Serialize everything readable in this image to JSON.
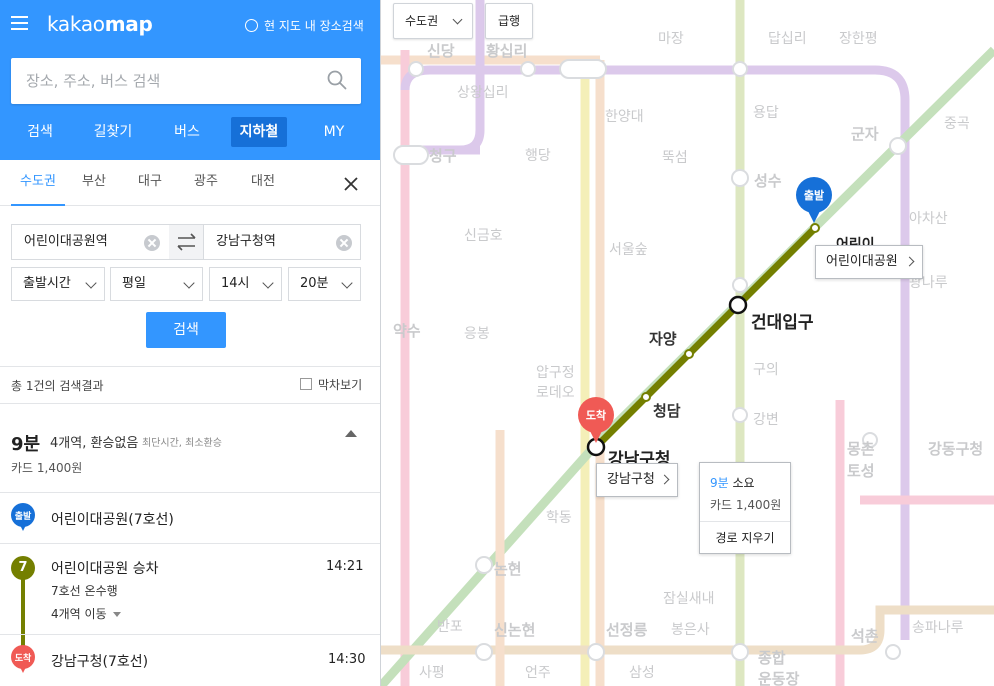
{
  "header": {
    "logo_kakao": "kakao",
    "logo_map": "map",
    "radio_label": "현 지도 내 장소검색",
    "search_placeholder": "장소, 주소, 버스 검색"
  },
  "nav_tabs": [
    "검색",
    "길찾기",
    "버스",
    "지하철",
    "MY"
  ],
  "active_nav_tab": "지하철",
  "regions": [
    "수도권",
    "부산",
    "대구",
    "광주",
    "대전"
  ],
  "active_region": "수도권",
  "route_form": {
    "origin": "어린이대공원역",
    "destination": "강남구청역",
    "time_type": "출발시간",
    "day_type": "평일",
    "hour": "14시",
    "minute": "20분",
    "search_button": "검색"
  },
  "results": {
    "count_text": "총 1건의 검색결과",
    "last_train_label": "막차보기",
    "route": {
      "duration": "9분",
      "info": "4개역, 환승없음",
      "tags": "최단시간, 최소환승",
      "fare": "카드 1,400원"
    },
    "steps": {
      "start_pin": "출발",
      "start_name": "어린이대공원(7호선)",
      "line_number": "7",
      "board_name": "어린이대공원 승차",
      "board_time": "14:21",
      "direction": "7호선 온수행",
      "stops": "4개역 이동",
      "end_pin": "도착",
      "end_name": "강남구청(7호선)",
      "end_time": "14:30"
    }
  },
  "map": {
    "region_button": "수도권",
    "express_button": "급행",
    "start_pin": "출발",
    "end_pin": "도착",
    "stations": {
      "origin_partial": "어린이",
      "konkuk": "건대입구",
      "jayang": "자양",
      "cheongdam": "청담",
      "gangnam_gu_office": "강남구청"
    },
    "callout_origin": "어린이대공원",
    "callout_dest": "강남구청",
    "summary": {
      "duration": "9분",
      "suffix": " 소요",
      "fare": "카드 1,400원",
      "clear_route": "경로 지우기"
    },
    "background_labels": [
      "신당",
      "황십리",
      "마장",
      "답십리",
      "장한평",
      "상왕십리",
      "한양대",
      "용답",
      "군자",
      "중곡",
      "청구",
      "행당",
      "뚝섬",
      "성수",
      "아차산",
      "신금호",
      "서울숲",
      "광나루",
      "약수",
      "응봉",
      "구의",
      "압구정",
      "로데오",
      "강변",
      "몽촌",
      "토성",
      "강동구청",
      "학동",
      "논현",
      "잠실새내",
      "신논현",
      "반포",
      "선정릉",
      "봉은사",
      "석촌",
      "송파나루",
      "사평",
      "언주",
      "삼성",
      "종합",
      "운동장"
    ],
    "line_colors": {
      "line7": "#747f00",
      "line2": "#c4e0bb",
      "line5": "#dcc9eb",
      "line9": "#eedec7",
      "line3": "#f6dfcc",
      "line8": "#f8ccd9",
      "bundang": "#f4efb8"
    }
  }
}
